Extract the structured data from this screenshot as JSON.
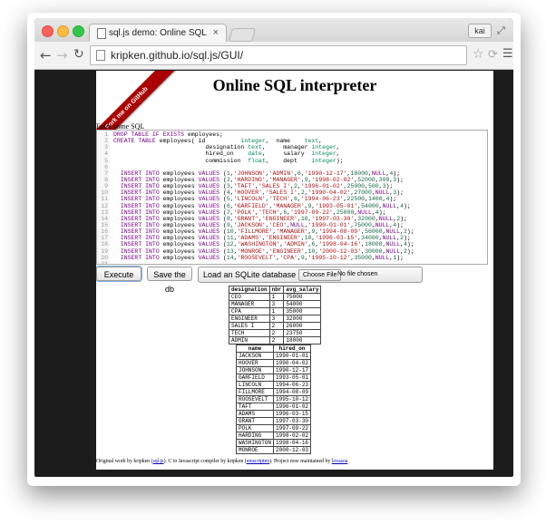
{
  "browser": {
    "tab_title": "sql.js demo: Online SQL int",
    "tab_close": "×",
    "profile_name": "kai",
    "url": "kripken.github.io/sql.js/GUI/"
  },
  "page": {
    "ribbon_text": "Fork me on GitHub",
    "title": "Online SQL interpreter",
    "editor_label": "Enter some SQL",
    "code_lines": [
      {
        "n": "1",
        "html": "<span class=\"kw\">DROP TABLE IF EXISTS</span> employees;"
      },
      {
        "n": "2",
        "html": "<span class=\"kw\">CREATE TABLE</span> employees( id          <span class=\"ty\">integer</span>,  name    <span class=\"ty\">text</span>,"
      },
      {
        "n": "3",
        "html": "                          designation <span class=\"ty\">text</span>,     manager <span class=\"ty\">integer</span>,"
      },
      {
        "n": "4",
        "html": "                          hired_on    <span class=\"ty\">date</span>,     salary  <span class=\"ty\">integer</span>,"
      },
      {
        "n": "5",
        "html": "                          commission  <span class=\"ty\">float</span>,    dept    <span class=\"ty\">integer</span>);"
      },
      {
        "n": "6",
        "html": ""
      },
      {
        "n": "7",
        "html": "  <span class=\"kw\">INSERT INTO</span> employees <span class=\"kw\">VALUES</span> (<span class=\"nm\">1</span>,<span class=\"st\">'JOHNSON'</span>,<span class=\"st\">'ADMIN'</span>,<span class=\"nm\">6</span>,<span class=\"st\">'1990-12-17'</span>,<span class=\"nm\">18000</span>,<span class=\"kw\">NULL</span>,<span class=\"nm\">4</span>);"
      },
      {
        "n": "8",
        "html": "  <span class=\"kw\">INSERT INTO</span> employees <span class=\"kw\">VALUES</span> (<span class=\"nm\">2</span>,<span class=\"st\">'HARDING'</span>,<span class=\"st\">'MANAGER'</span>,<span class=\"nm\">9</span>,<span class=\"st\">'1998-02-02'</span>,<span class=\"nm\">52000</span>,<span class=\"nm\">300</span>,<span class=\"nm\">3</span>);"
      },
      {
        "n": "9",
        "html": "  <span class=\"kw\">INSERT INTO</span> employees <span class=\"kw\">VALUES</span> (<span class=\"nm\">3</span>,<span class=\"st\">'TAFT'</span>,<span class=\"st\">'SALES I'</span>,<span class=\"nm\">2</span>,<span class=\"st\">'1996-01-02'</span>,<span class=\"nm\">25000</span>,<span class=\"nm\">500</span>,<span class=\"nm\">3</span>);"
      },
      {
        "n": "10",
        "html": "  <span class=\"kw\">INSERT INTO</span> employees <span class=\"kw\">VALUES</span> (<span class=\"nm\">4</span>,<span class=\"st\">'HOOVER'</span>,<span class=\"st\">'SALES I'</span>,<span class=\"nm\">2</span>,<span class=\"st\">'1990-04-02'</span>,<span class=\"nm\">27000</span>,<span class=\"kw\">NULL</span>,<span class=\"nm\">3</span>);"
      },
      {
        "n": "11",
        "html": "  <span class=\"kw\">INSERT INTO</span> employees <span class=\"kw\">VALUES</span> (<span class=\"nm\">5</span>,<span class=\"st\">'LINCOLN'</span>,<span class=\"st\">'TECH'</span>,<span class=\"nm\">6</span>,<span class=\"st\">'1994-06-23'</span>,<span class=\"nm\">22500</span>,<span class=\"nm\">1400</span>,<span class=\"nm\">4</span>);"
      },
      {
        "n": "12",
        "html": "  <span class=\"kw\">INSERT INTO</span> employees <span class=\"kw\">VALUES</span> (<span class=\"nm\">6</span>,<span class=\"st\">'GARFIELD'</span>,<span class=\"st\">'MANAGER'</span>,<span class=\"nm\">9</span>,<span class=\"st\">'1993-05-01'</span>,<span class=\"nm\">54000</span>,<span class=\"kw\">NULL</span>,<span class=\"nm\">4</span>);"
      },
      {
        "n": "13",
        "html": "  <span class=\"kw\">INSERT INTO</span> employees <span class=\"kw\">VALUES</span> (<span class=\"nm\">7</span>,<span class=\"st\">'POLK'</span>,<span class=\"st\">'TECH'</span>,<span class=\"nm\">6</span>,<span class=\"st\">'1997-09-22'</span>,<span class=\"nm\">25000</span>,<span class=\"kw\">NULL</span>,<span class=\"nm\">4</span>);"
      },
      {
        "n": "14",
        "html": "  <span class=\"kw\">INSERT INTO</span> employees <span class=\"kw\">VALUES</span> (<span class=\"nm\">8</span>,<span class=\"st\">'GRANT'</span>,<span class=\"st\">'ENGINEER'</span>,<span class=\"nm\">10</span>,<span class=\"st\">'1997-03-30'</span>,<span class=\"nm\">32000</span>,<span class=\"kw\">NULL</span>,<span class=\"nm\">2</span>);"
      },
      {
        "n": "15",
        "html": "  <span class=\"kw\">INSERT INTO</span> employees <span class=\"kw\">VALUES</span> (<span class=\"nm\">9</span>,<span class=\"st\">'JACKSON'</span>,<span class=\"st\">'CEO'</span>,<span class=\"kw\">NULL</span>,<span class=\"st\">'1990-01-01'</span>,<span class=\"nm\">75000</span>,<span class=\"kw\">NULL</span>,<span class=\"nm\">4</span>);"
      },
      {
        "n": "16",
        "html": "  <span class=\"kw\">INSERT INTO</span> employees <span class=\"kw\">VALUES</span> (<span class=\"nm\">10</span>,<span class=\"st\">'FILLMORE'</span>,<span class=\"st\">'MANAGER'</span>,<span class=\"nm\">9</span>,<span class=\"st\">'1994-08-09'</span>,<span class=\"nm\">56000</span>,<span class=\"kw\">NULL</span>,<span class=\"nm\">2</span>);"
      },
      {
        "n": "17",
        "html": "  <span class=\"kw\">INSERT INTO</span> employees <span class=\"kw\">VALUES</span> (<span class=\"nm\">11</span>,<span class=\"st\">'ADAMS'</span>,<span class=\"st\">'ENGINEER'</span>,<span class=\"nm\">10</span>,<span class=\"st\">'1996-03-15'</span>,<span class=\"nm\">34000</span>,<span class=\"kw\">NULL</span>,<span class=\"nm\">2</span>);"
      },
      {
        "n": "18",
        "html": "  <span class=\"kw\">INSERT INTO</span> employees <span class=\"kw\">VALUES</span> (<span class=\"nm\">12</span>,<span class=\"st\">'WASHINGTON'</span>,<span class=\"st\">'ADMIN'</span>,<span class=\"nm\">6</span>,<span class=\"st\">'1998-04-16'</span>,<span class=\"nm\">18000</span>,<span class=\"kw\">NULL</span>,<span class=\"nm\">4</span>);"
      },
      {
        "n": "19",
        "html": "  <span class=\"kw\">INSERT INTO</span> employees <span class=\"kw\">VALUES</span> (<span class=\"nm\">13</span>,<span class=\"st\">'MONROE'</span>,<span class=\"st\">'ENGINEER'</span>,<span class=\"nm\">10</span>,<span class=\"st\">'2000-12-03'</span>,<span class=\"nm\">30000</span>,<span class=\"kw\">NULL</span>,<span class=\"nm\">2</span>);"
      },
      {
        "n": "20",
        "html": "  <span class=\"kw\">INSERT INTO</span> employees <span class=\"kw\">VALUES</span> (<span class=\"nm\">14</span>,<span class=\"st\">'ROOSEVELT'</span>,<span class=\"st\">'CPA'</span>,<span class=\"nm\">9</span>,<span class=\"st\">'1995-10-12'</span>,<span class=\"nm\">35000</span>,<span class=\"kw\">NULL</span>,<span class=\"nm\">1</span>);"
      },
      {
        "n": "21",
        "html": ""
      },
      {
        "n": "22",
        "html": "<span class=\"kw\">SELECT</span> designation,<span class=\"kw\">COUNT</span>(*) <span class=\"kw\">AS</span> nbr, (<span class=\"kw\">AVG</span>(salary)) <span class=\"kw\">AS</span> avg_salary <span class=\"kw\">FROM</span> employees <span class=\"kw\">GROUP BY</span> designation <span class=\"kw\">ORDER BY</span> avg_salary <span class=\"kw\">DESC</span>;"
      },
      {
        "n": "23",
        "html": "<span class=\"kw\">SELECT</span> name,hired_on <span class=\"kw\">FROM</span> employees <span class=\"kw\">ORDER BY</span> hired_on;"
      }
    ],
    "buttons": {
      "execute": "Execute",
      "save": "Save the db",
      "load_label": "Load an SQLite database file:",
      "choose_file": "Choose File",
      "no_file": "No file chosen"
    },
    "result1": {
      "columns": [
        "designation",
        "nbr",
        "avg_salary"
      ],
      "rows": [
        [
          "CEO",
          "1",
          "75000"
        ],
        [
          "MANAGER",
          "3",
          "54000"
        ],
        [
          "CPA",
          "1",
          "35000"
        ],
        [
          "ENGINEER",
          "3",
          "32000"
        ],
        [
          "SALES I",
          "2",
          "26000"
        ],
        [
          "TECH",
          "2",
          "23750"
        ],
        [
          "ADMIN",
          "2",
          "18000"
        ]
      ]
    },
    "result2": {
      "columns": [
        "name",
        "hired_on"
      ],
      "rows": [
        [
          "JACKSON",
          "1990-01-01"
        ],
        [
          "HOOVER",
          "1990-04-02"
        ],
        [
          "JOHNSON",
          "1990-12-17"
        ],
        [
          "GARFIELD",
          "1993-05-01"
        ],
        [
          "LINCOLN",
          "1994-06-23"
        ],
        [
          "FILLMORE",
          "1994-08-09"
        ],
        [
          "ROOSEVELT",
          "1995-10-12"
        ],
        [
          "TAFT",
          "1996-01-02"
        ],
        [
          "ADAMS",
          "1996-03-15"
        ],
        [
          "GRANT",
          "1997-03-30"
        ],
        [
          "POLK",
          "1997-09-22"
        ],
        [
          "HARDING",
          "1998-02-02"
        ],
        [
          "WASHINGTON",
          "1998-04-16"
        ],
        [
          "MONROE",
          "2000-12-03"
        ]
      ]
    },
    "footer": {
      "t1": "Original work by kripken (",
      "l1": "sql.js",
      "t2": "). C to Javascript compiler by kripken (",
      "l2": "emscripten",
      "t3": "). Project now maintained by ",
      "l3": "lovasoa"
    }
  }
}
